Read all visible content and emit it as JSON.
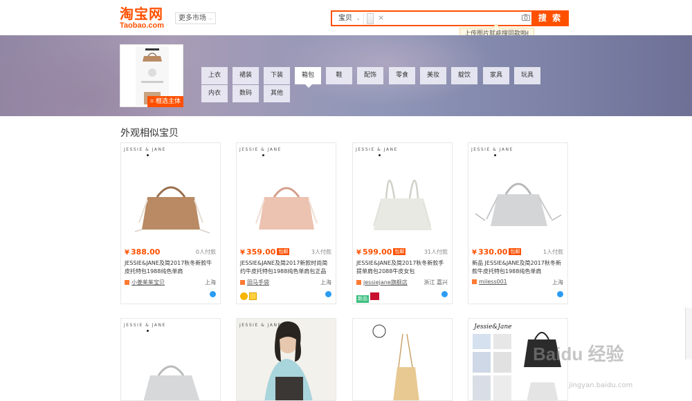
{
  "header": {
    "logo_cn": "淘宝网",
    "logo_en": "Taobao.com",
    "market_label": "更多市场",
    "search_type": "宝贝",
    "search_value": "",
    "search_button": "搜 索",
    "tooltip": "上传图片就能搜同款啦!"
  },
  "banner": {
    "crop_label": "框选主体",
    "categories": [
      "上衣",
      "裙装",
      "下装",
      "箱包",
      "鞋",
      "配饰",
      "零食",
      "美妆",
      "靛饮",
      "家具",
      "玩具",
      "内衣",
      "数码",
      "其他"
    ],
    "active_category": "箱包"
  },
  "section_title": "外观相似宝贝",
  "brand": "JESSIE & JANE",
  "products": [
    {
      "price": "388.00",
      "baoyou": "",
      "buyers": "0人付款",
      "title": "JESSIE&JANE及简2017秋冬新款牛皮托特包1988纯色单肩",
      "shop": "小姜茱茱宝贝",
      "location": "上海",
      "bag_color": "#b98a63"
    },
    {
      "price": "359.00",
      "baoyou": "包邮",
      "buyers": "3人付款",
      "title": "JESSIE&JANE及简2017新款时尚简约牛皮托特包1988纯色单肩包正品",
      "shop": "田马手袋",
      "location": "上海",
      "bag_color": "#ecc2b0"
    },
    {
      "price": "599.00",
      "baoyou": "包邮",
      "buyers": "31人付款",
      "title": "JESSIE&JANE及简2017秋冬新款手提单肩包2088牛皮女包",
      "shop": "jessiejane旗舰店",
      "location": "浙江 嘉兴",
      "bag_color": "#e7e9e2"
    },
    {
      "price": "330.00",
      "baoyou": "包邮",
      "buyers": "1人付款",
      "title": "新品 JESSIE&JANE及简2017秋冬新款牛皮托特包1988纯色单肩",
      "shop": "miless001",
      "location": "上海",
      "bag_color": "#d4d5d6"
    }
  ],
  "badges": {
    "new": "新品"
  },
  "watermark": {
    "main": "Baidu 经验",
    "sub": "jingyan.baidu.com"
  },
  "colors": {
    "accent": "#ff5000"
  }
}
